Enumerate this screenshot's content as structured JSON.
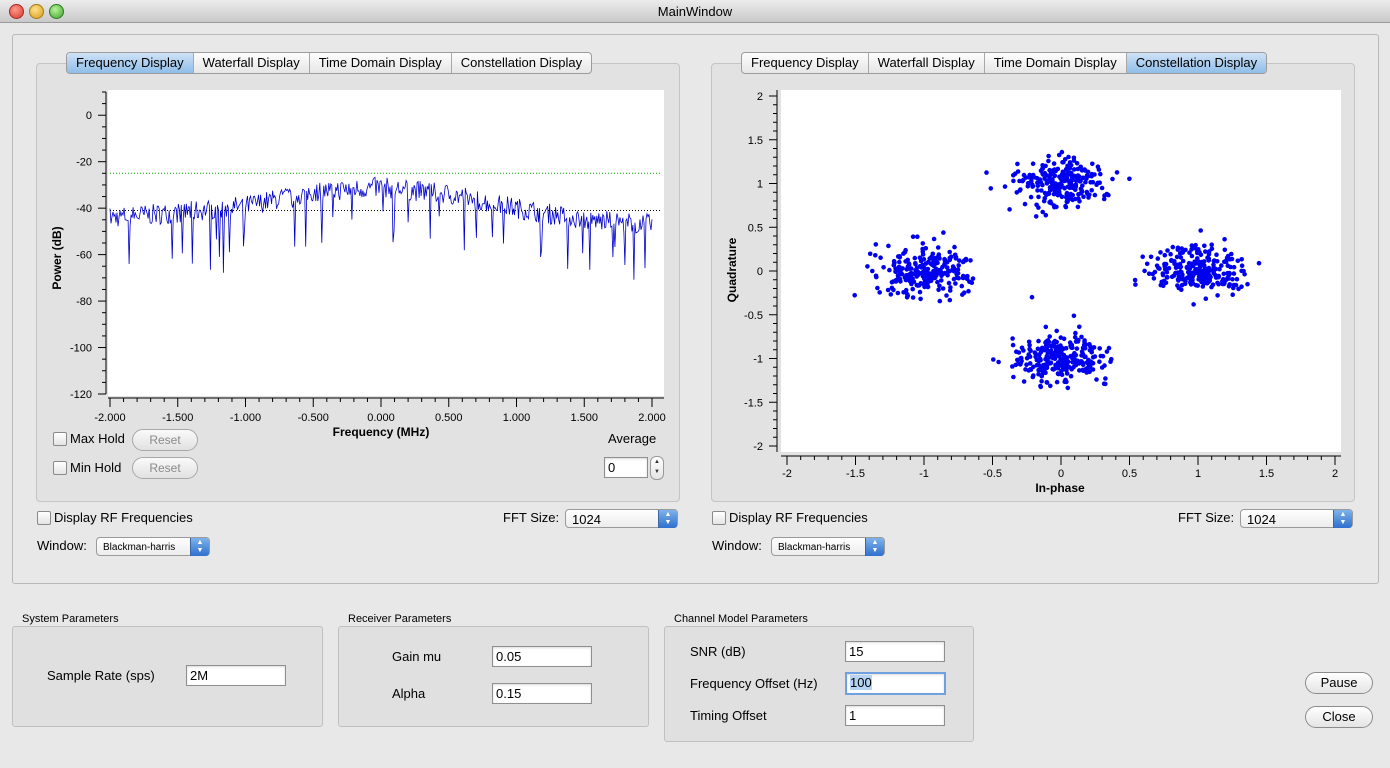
{
  "window": {
    "title": "MainWindow"
  },
  "tabs_left": [
    "Frequency Display",
    "Waterfall Display",
    "Time Domain Display",
    "Constellation Display"
  ],
  "tabs_right": [
    "Frequency Display",
    "Waterfall Display",
    "Time Domain Display",
    "Constellation Display"
  ],
  "left_panel": {
    "max_hold_label": "Max Hold",
    "min_hold_label": "Min Hold",
    "reset_label": "Reset",
    "average_label": "Average",
    "average_value": "0",
    "display_rf_label": "Display RF Frequencies",
    "fft_label": "FFT Size:",
    "fft_value": "1024",
    "window_label": "Window:",
    "window_value": "Blackman-harris"
  },
  "right_panel": {
    "display_rf_label": "Display RF Frequencies",
    "fft_label": "FFT Size:",
    "fft_value": "1024",
    "window_label": "Window:",
    "window_value": "Blackman-harris"
  },
  "system": {
    "title": "System Parameters",
    "sample_rate_label": "Sample Rate (sps)",
    "sample_rate_value": "2M"
  },
  "receiver": {
    "title": "Receiver Parameters",
    "gain_label": "Gain mu",
    "gain_value": "0.05",
    "alpha_label": "Alpha",
    "alpha_value": "0.15"
  },
  "channel": {
    "title": "Channel Model Parameters",
    "snr_label": "SNR (dB)",
    "snr_value": "15",
    "freq_label": "Frequency Offset (Hz)",
    "freq_value": "100",
    "timing_label": "Timing Offset",
    "timing_value": "1"
  },
  "buttons": {
    "pause": "Pause",
    "close": "Close"
  },
  "colors": {
    "trace": "#0000cc",
    "max_line": "#00b000",
    "avg_line": "#000000",
    "tab_active": "#9cc4ec"
  },
  "chart_data": [
    {
      "type": "line",
      "xlabel": "Frequency (MHz)",
      "ylabel": "Power (dB)",
      "xlim": [
        -2.0,
        2.0
      ],
      "ylim": [
        -120,
        10
      ],
      "xticks": [
        "-2.000",
        "-1.500",
        "-1.000",
        "-0.500",
        "0.000",
        "0.500",
        "1.000",
        "1.500",
        "2.000"
      ],
      "yticks": [
        "0",
        "-20",
        "-40",
        "-60",
        "-80",
        "-100",
        "-120"
      ],
      "envelope": {
        "x": [
          -2.0,
          -1.5,
          -1.0,
          -0.5,
          0.0,
          0.5,
          1.0,
          1.5,
          2.0
        ],
        "y": [
          -44,
          -42,
          -39,
          -33,
          -31,
          -34,
          -40,
          -45,
          -47
        ]
      },
      "max_hold_level": -25,
      "avg_level": -41
    },
    {
      "type": "scatter",
      "xlabel": "In-phase",
      "ylabel": "Quadrature",
      "xlim": [
        -2,
        2
      ],
      "ylim": [
        -2,
        2
      ],
      "xticks": [
        "-2",
        "-1.5",
        "-1",
        "-0.5",
        "0",
        "0.5",
        "1",
        "1.5",
        "2"
      ],
      "yticks": [
        "2",
        "1.5",
        "1",
        "0.5",
        "0",
        "-0.5",
        "-1",
        "-1.5",
        "-2"
      ],
      "clusters": [
        {
          "x": 0,
          "y": 1
        },
        {
          "x": -1,
          "y": 0
        },
        {
          "x": 1,
          "y": 0
        },
        {
          "x": 0,
          "y": -1
        }
      ],
      "spread": 0.15
    }
  ]
}
